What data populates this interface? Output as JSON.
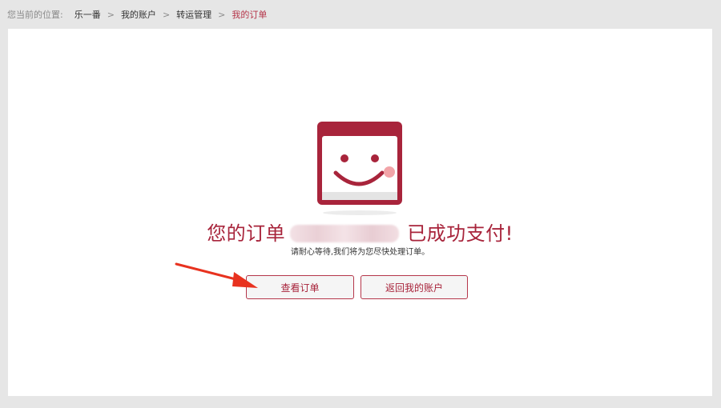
{
  "breadcrumb": {
    "lead": "您当前的位置:",
    "items": [
      "乐一番",
      "我的账户",
      "转运管理"
    ],
    "current": "我的订单",
    "separator": ">"
  },
  "status": {
    "title_prefix": "您的订单",
    "title_suffix": "已成功支付!",
    "subtitle": "请耐心等待,我们将为您尽快处理订单。"
  },
  "actions": {
    "view_order": "查看订单",
    "back_to_account": "返回我的账户"
  },
  "colors": {
    "brand": "#a8243b",
    "background": "#e6e6e6",
    "panel": "#ffffff",
    "arrow": "#e8321f"
  },
  "icons": {
    "mascot": "smiling-calendar-icon",
    "annotation": "red-arrow-icon"
  }
}
